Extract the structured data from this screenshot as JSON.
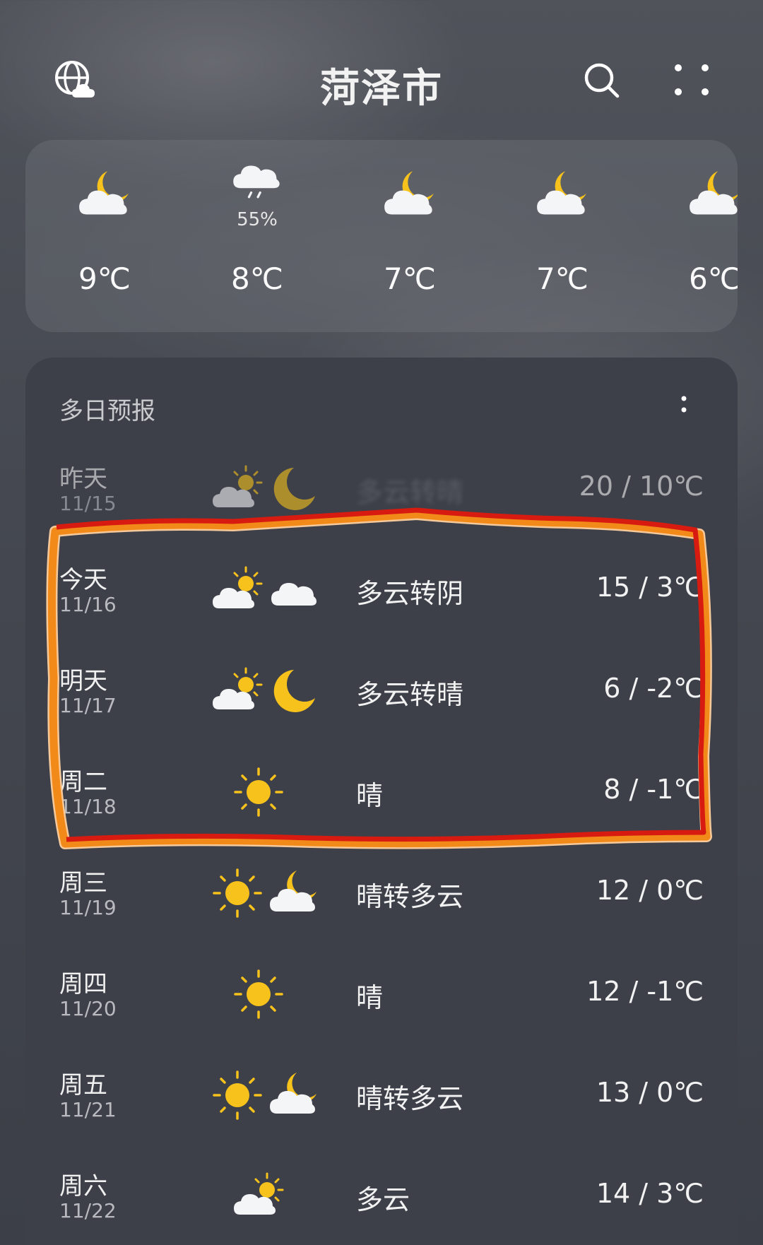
{
  "header": {
    "city": "菏泽市",
    "left_icon": "globe-cloud-icon",
    "search_icon": "search-icon",
    "menu_icon": "more-dots-icon"
  },
  "hourly": [
    {
      "icon": "moon-cloud-icon",
      "precip": "",
      "temp": "9℃"
    },
    {
      "icon": "rain-cloud-icon",
      "precip": "55%",
      "temp": "8℃"
    },
    {
      "icon": "moon-cloud-icon",
      "precip": "",
      "temp": "7℃"
    },
    {
      "icon": "moon-cloud-icon",
      "precip": "",
      "temp": "7℃"
    },
    {
      "icon": "moon-cloud-icon",
      "precip": "",
      "temp": "6℃"
    }
  ],
  "daily": {
    "title": "多日预报",
    "rows": [
      {
        "name": "昨天",
        "date": "11/15",
        "cond": "多云转晴",
        "temp": "20 / 10℃",
        "icons": [
          "partly-cloudy-icon",
          "moon-icon"
        ]
      },
      {
        "name": "今天",
        "date": "11/16",
        "cond": "多云转阴",
        "temp": "15 / 3℃",
        "icons": [
          "partly-cloudy-icon",
          "cloud-icon"
        ]
      },
      {
        "name": "明天",
        "date": "11/17",
        "cond": "多云转晴",
        "temp": "6 / -2℃",
        "icons": [
          "partly-cloudy-icon",
          "moon-icon"
        ]
      },
      {
        "name": "周二",
        "date": "11/18",
        "cond": "晴",
        "temp": "8 / -1℃",
        "icons": [
          "sun-icon"
        ]
      },
      {
        "name": "周三",
        "date": "11/19",
        "cond": "晴转多云",
        "temp": "12 / 0℃",
        "icons": [
          "sun-icon",
          "moon-cloud-icon"
        ]
      },
      {
        "name": "周四",
        "date": "11/20",
        "cond": "晴",
        "temp": "12 / -1℃",
        "icons": [
          "sun-icon"
        ]
      },
      {
        "name": "周五",
        "date": "11/21",
        "cond": "晴转多云",
        "temp": "13 / 0℃",
        "icons": [
          "sun-icon",
          "moon-cloud-icon"
        ]
      },
      {
        "name": "周六",
        "date": "11/22",
        "cond": "多云",
        "temp": "14 / 3℃",
        "icons": [
          "partly-cloudy-icon"
        ]
      }
    ]
  },
  "colors": {
    "sun": "#f7c21b",
    "cloud": "#f4f5f7",
    "highlight_red": "#d81b10",
    "highlight_orange": "#f28a1a"
  }
}
